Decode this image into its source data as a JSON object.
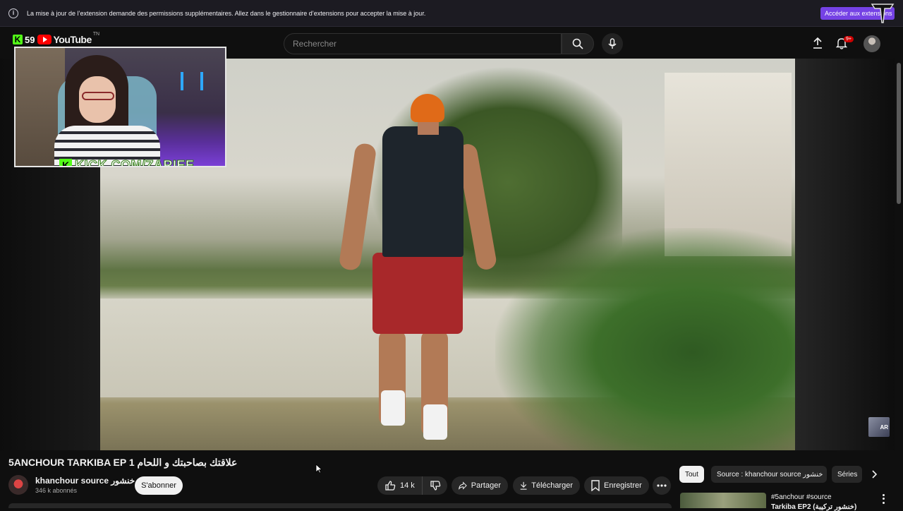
{
  "extension_bar": {
    "message": "La mise à jour de l’extension demande des permissions supplémentaires. Allez dans le gestionnaire d’extensions pour accepter la mise à jour.",
    "button_label": "Accéder aux extensions"
  },
  "header": {
    "kick_count": "59",
    "logo_text": "YouTube",
    "logo_region": "TN",
    "search_placeholder": "Rechercher",
    "notification_count": "9+"
  },
  "overlay": {
    "facecam_url": "KICK.COM/ZARIEE",
    "mini_thumb_text": "AR"
  },
  "video": {
    "title": "5ANCHOUR TARKIBA EP 1 علاقتك بصاحبتك و اللحام",
    "channel_name": "khanchour source خنشور",
    "subscribers": "346 k abonnés",
    "subscribe_label": "S'abonner",
    "like_count": "14 k",
    "share_label": "Partager",
    "download_label": "Télécharger",
    "save_label": "Enregistrer"
  },
  "chips": {
    "items": [
      "Tout",
      "Source : khanchour source خنشور",
      "Séries"
    ]
  },
  "recommendation": {
    "tags": "#5anchour  #source",
    "title": "Tarkiba EP2  (خنشور تركيبة)"
  },
  "colors": {
    "subscribe_bg": "#f1f1f1",
    "extension_button": "#7542e5",
    "kick_green": "#53fc18",
    "youtube_red": "#ff0000",
    "notification_badge": "#cc0000"
  }
}
